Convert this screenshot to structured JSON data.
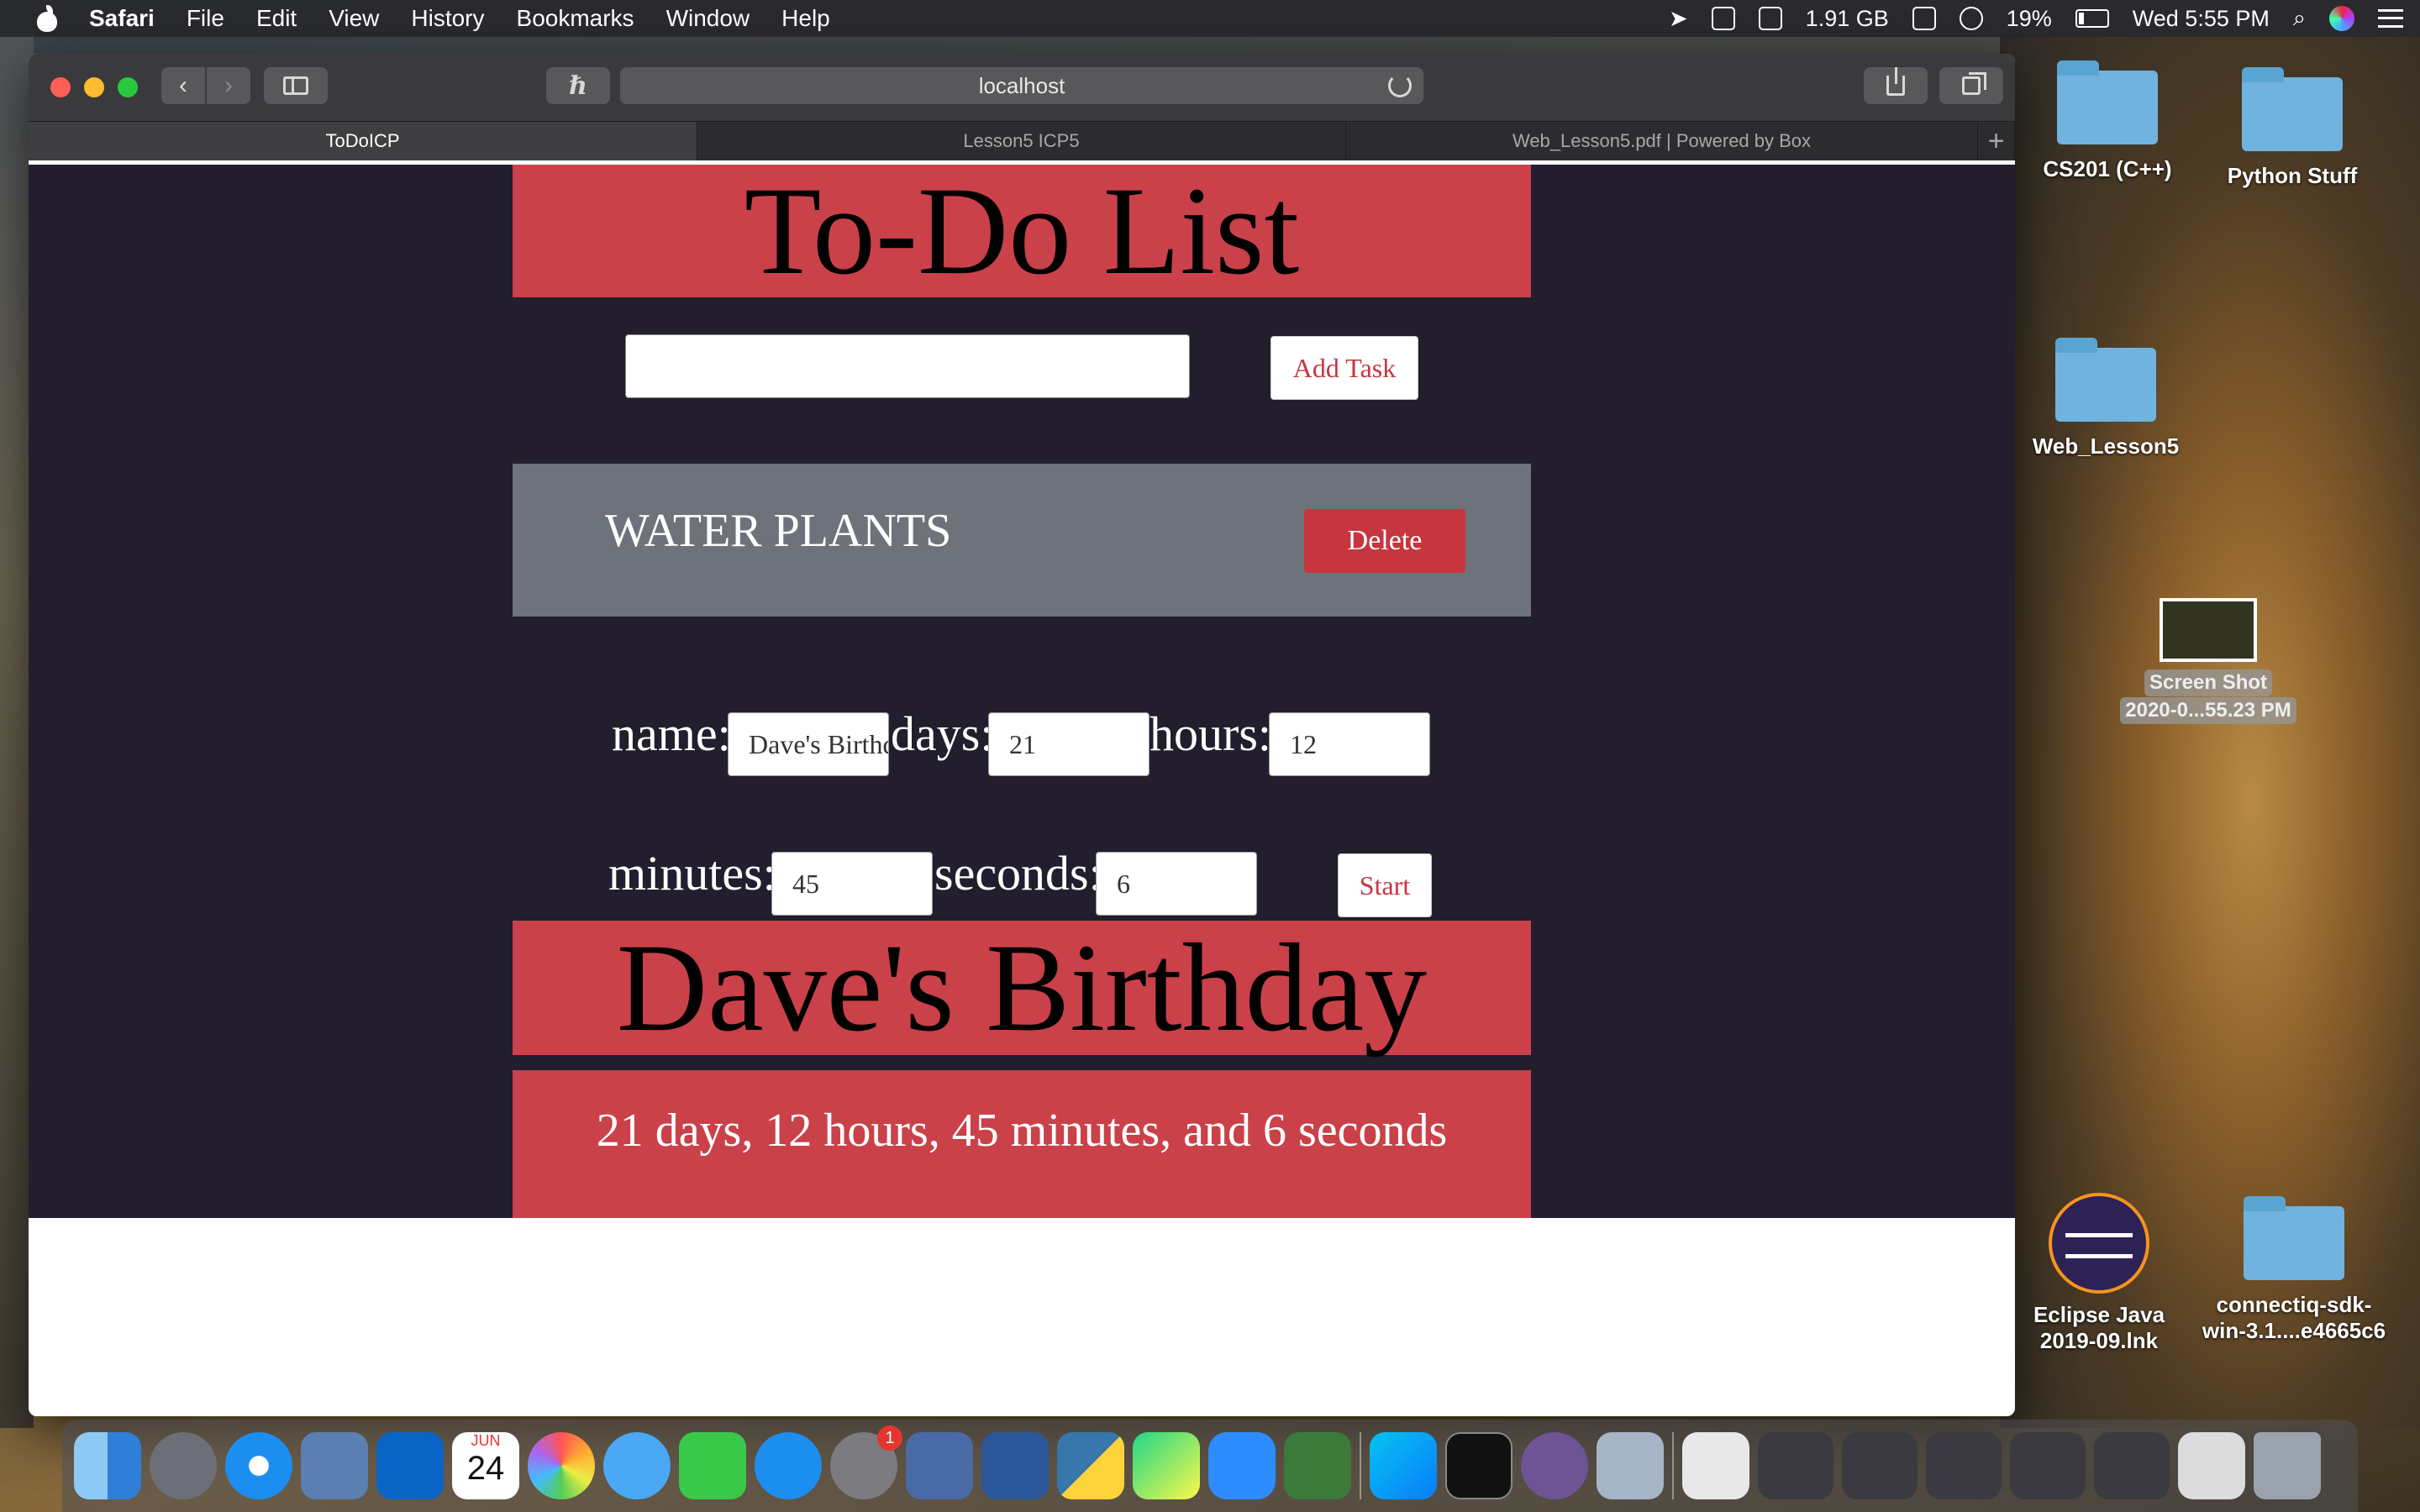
{
  "menubar": {
    "app_name": "Safari",
    "items": [
      "File",
      "Edit",
      "View",
      "History",
      "Bookmarks",
      "Window",
      "Help"
    ],
    "memory": "1.91 GB",
    "battery_percent": "19%",
    "clock": "Wed 5:55 PM"
  },
  "browser": {
    "address": "localhost",
    "tabs": [
      {
        "label": "ToDoICP",
        "active": true
      },
      {
        "label": "Lesson5 ICP5",
        "active": false
      },
      {
        "label": "Web_Lesson5.pdf | Powered by Box",
        "active": false
      }
    ],
    "new_tab_label": "+"
  },
  "page": {
    "title": "To-Do List",
    "task_input_value": "",
    "add_task_label": "Add Task",
    "tasks": [
      {
        "text": "WATER PLANTS",
        "delete_label": "Delete"
      }
    ],
    "timer": {
      "name_label": "name:",
      "name_value": "Dave's Birthday",
      "days_label": "days:",
      "days_value": "21",
      "hours_label": "hours:",
      "hours_value": "12",
      "minutes_label": "minutes:",
      "minutes_value": "45",
      "seconds_label": "seconds:",
      "seconds_value": "6",
      "start_label": "Start"
    },
    "event_title": "Dave's Birthday",
    "countdown_text": "21 days, 12 hours, 45 minutes, and 6 seconds"
  },
  "desktop": {
    "icons": [
      {
        "label": "CS201 (C++)"
      },
      {
        "label": "Python Stuff"
      },
      {
        "label": "Web_Lesson5"
      },
      {
        "label_line1": "Screen Shot",
        "label_line2": "2020-0...55.23 PM"
      },
      {
        "label_line1": "Eclipse Java",
        "label_line2": "2019-09.lnk"
      },
      {
        "label_line1": "connectiq-sdk-",
        "label_line2": "win-3.1....e4665c6"
      }
    ]
  },
  "dock": {
    "calendar_month": "JUN",
    "calendar_day": "24",
    "settings_badge": "1"
  },
  "colors": {
    "banner_red": "#ca4149",
    "page_bg": "#221e2e",
    "task_row_gray": "#6d727b",
    "button_red": "#c7353f"
  }
}
